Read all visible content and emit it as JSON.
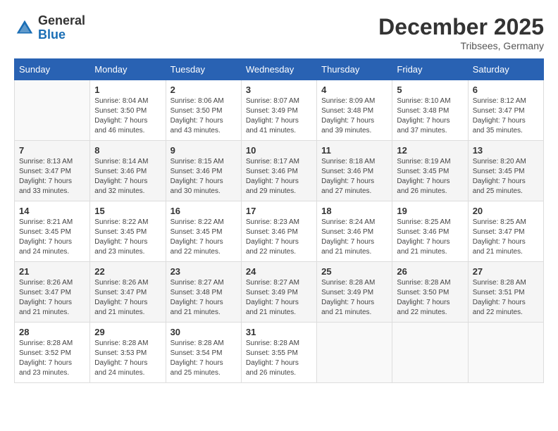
{
  "logo": {
    "general": "General",
    "blue": "Blue"
  },
  "header": {
    "month": "December 2025",
    "location": "Tribsees, Germany"
  },
  "days_of_week": [
    "Sunday",
    "Monday",
    "Tuesday",
    "Wednesday",
    "Thursday",
    "Friday",
    "Saturday"
  ],
  "weeks": [
    [
      {
        "day": "",
        "info": ""
      },
      {
        "day": "1",
        "info": "Sunrise: 8:04 AM\nSunset: 3:50 PM\nDaylight: 7 hours\nand 46 minutes."
      },
      {
        "day": "2",
        "info": "Sunrise: 8:06 AM\nSunset: 3:50 PM\nDaylight: 7 hours\nand 43 minutes."
      },
      {
        "day": "3",
        "info": "Sunrise: 8:07 AM\nSunset: 3:49 PM\nDaylight: 7 hours\nand 41 minutes."
      },
      {
        "day": "4",
        "info": "Sunrise: 8:09 AM\nSunset: 3:48 PM\nDaylight: 7 hours\nand 39 minutes."
      },
      {
        "day": "5",
        "info": "Sunrise: 8:10 AM\nSunset: 3:48 PM\nDaylight: 7 hours\nand 37 minutes."
      },
      {
        "day": "6",
        "info": "Sunrise: 8:12 AM\nSunset: 3:47 PM\nDaylight: 7 hours\nand 35 minutes."
      }
    ],
    [
      {
        "day": "7",
        "info": "Sunrise: 8:13 AM\nSunset: 3:47 PM\nDaylight: 7 hours\nand 33 minutes."
      },
      {
        "day": "8",
        "info": "Sunrise: 8:14 AM\nSunset: 3:46 PM\nDaylight: 7 hours\nand 32 minutes."
      },
      {
        "day": "9",
        "info": "Sunrise: 8:15 AM\nSunset: 3:46 PM\nDaylight: 7 hours\nand 30 minutes."
      },
      {
        "day": "10",
        "info": "Sunrise: 8:17 AM\nSunset: 3:46 PM\nDaylight: 7 hours\nand 29 minutes."
      },
      {
        "day": "11",
        "info": "Sunrise: 8:18 AM\nSunset: 3:46 PM\nDaylight: 7 hours\nand 27 minutes."
      },
      {
        "day": "12",
        "info": "Sunrise: 8:19 AM\nSunset: 3:45 PM\nDaylight: 7 hours\nand 26 minutes."
      },
      {
        "day": "13",
        "info": "Sunrise: 8:20 AM\nSunset: 3:45 PM\nDaylight: 7 hours\nand 25 minutes."
      }
    ],
    [
      {
        "day": "14",
        "info": "Sunrise: 8:21 AM\nSunset: 3:45 PM\nDaylight: 7 hours\nand 24 minutes."
      },
      {
        "day": "15",
        "info": "Sunrise: 8:22 AM\nSunset: 3:45 PM\nDaylight: 7 hours\nand 23 minutes."
      },
      {
        "day": "16",
        "info": "Sunrise: 8:22 AM\nSunset: 3:45 PM\nDaylight: 7 hours\nand 22 minutes."
      },
      {
        "day": "17",
        "info": "Sunrise: 8:23 AM\nSunset: 3:46 PM\nDaylight: 7 hours\nand 22 minutes."
      },
      {
        "day": "18",
        "info": "Sunrise: 8:24 AM\nSunset: 3:46 PM\nDaylight: 7 hours\nand 21 minutes."
      },
      {
        "day": "19",
        "info": "Sunrise: 8:25 AM\nSunset: 3:46 PM\nDaylight: 7 hours\nand 21 minutes."
      },
      {
        "day": "20",
        "info": "Sunrise: 8:25 AM\nSunset: 3:47 PM\nDaylight: 7 hours\nand 21 minutes."
      }
    ],
    [
      {
        "day": "21",
        "info": "Sunrise: 8:26 AM\nSunset: 3:47 PM\nDaylight: 7 hours\nand 21 minutes."
      },
      {
        "day": "22",
        "info": "Sunrise: 8:26 AM\nSunset: 3:47 PM\nDaylight: 7 hours\nand 21 minutes."
      },
      {
        "day": "23",
        "info": "Sunrise: 8:27 AM\nSunset: 3:48 PM\nDaylight: 7 hours\nand 21 minutes."
      },
      {
        "day": "24",
        "info": "Sunrise: 8:27 AM\nSunset: 3:49 PM\nDaylight: 7 hours\nand 21 minutes."
      },
      {
        "day": "25",
        "info": "Sunrise: 8:28 AM\nSunset: 3:49 PM\nDaylight: 7 hours\nand 21 minutes."
      },
      {
        "day": "26",
        "info": "Sunrise: 8:28 AM\nSunset: 3:50 PM\nDaylight: 7 hours\nand 22 minutes."
      },
      {
        "day": "27",
        "info": "Sunrise: 8:28 AM\nSunset: 3:51 PM\nDaylight: 7 hours\nand 22 minutes."
      }
    ],
    [
      {
        "day": "28",
        "info": "Sunrise: 8:28 AM\nSunset: 3:52 PM\nDaylight: 7 hours\nand 23 minutes."
      },
      {
        "day": "29",
        "info": "Sunrise: 8:28 AM\nSunset: 3:53 PM\nDaylight: 7 hours\nand 24 minutes."
      },
      {
        "day": "30",
        "info": "Sunrise: 8:28 AM\nSunset: 3:54 PM\nDaylight: 7 hours\nand 25 minutes."
      },
      {
        "day": "31",
        "info": "Sunrise: 8:28 AM\nSunset: 3:55 PM\nDaylight: 7 hours\nand 26 minutes."
      },
      {
        "day": "",
        "info": ""
      },
      {
        "day": "",
        "info": ""
      },
      {
        "day": "",
        "info": ""
      }
    ]
  ]
}
